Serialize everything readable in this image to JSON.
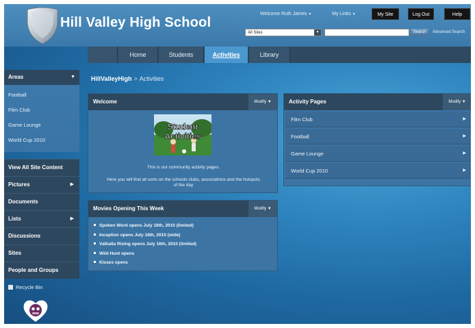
{
  "header": {
    "site_title": "Hill Valley High School",
    "welcome": "Welcome Ruth James",
    "my_links": "My Links",
    "buttons": {
      "my_site": "My Site",
      "log_out": "Log Out",
      "help": "Help"
    },
    "search": {
      "scope": "All Sites",
      "button": "Search",
      "advanced": "Advanced Search"
    }
  },
  "topnav": {
    "tabs": [
      {
        "label": "Home"
      },
      {
        "label": "Students"
      },
      {
        "label": "Activities",
        "selected": true
      },
      {
        "label": "Library"
      }
    ]
  },
  "leftnav": {
    "areas_heading": "Areas",
    "areas": [
      {
        "label": "Football"
      },
      {
        "label": "Film Club"
      },
      {
        "label": "Game Lounge"
      },
      {
        "label": "World Cup 2010"
      }
    ],
    "quick_launch": [
      {
        "label": "View All Site Content"
      },
      {
        "label": "Pictures"
      },
      {
        "label": "Documents"
      },
      {
        "label": "Lists"
      },
      {
        "label": "Discussions"
      },
      {
        "label": "Sites"
      },
      {
        "label": "People and Groups"
      }
    ],
    "recycle_bin": "Recycle Bin"
  },
  "breadcrumb": {
    "root": "HillValleyHigh",
    "separator": ">",
    "current": "Activities"
  },
  "welcome_part": {
    "title": "Welcome",
    "modify": "Modify",
    "image_text_line1": "Student",
    "image_text_line2": "Activities",
    "line1": "This is our community activity pages.",
    "line2": "Here you will find all sorts on the schools clubs, associations and the hotspots of the day"
  },
  "movies_part": {
    "title": "Movies Opening This Week",
    "modify": "Modify",
    "items": [
      "Spoken Word opens July 16th, 2010 (limited)",
      "Inception opens July 16th, 2010 (wide)",
      "Valhalla Rising opens July 16th, 2010 (limited)",
      "Wild Hunt opens",
      "Kisses opens"
    ]
  },
  "activity_part": {
    "title": "Activity Pages",
    "modify": "Modify",
    "items": [
      {
        "label": "Film Club"
      },
      {
        "label": "Football"
      },
      {
        "label": "Game Lounge"
      },
      {
        "label": "World Cup 2010"
      }
    ]
  },
  "colors": {
    "nav_dark": "#2d475e",
    "selected_tab": "#4b98d0",
    "panel": "#3c74a4",
    "background": "#2f86c0"
  },
  "icons": {
    "logo": "shield-logo",
    "recycle": "recycle-bin-icon",
    "heart": "heart-mascot-logo",
    "dropdown": "chevron-down-icon",
    "submenu": "chevron-right-icon"
  }
}
